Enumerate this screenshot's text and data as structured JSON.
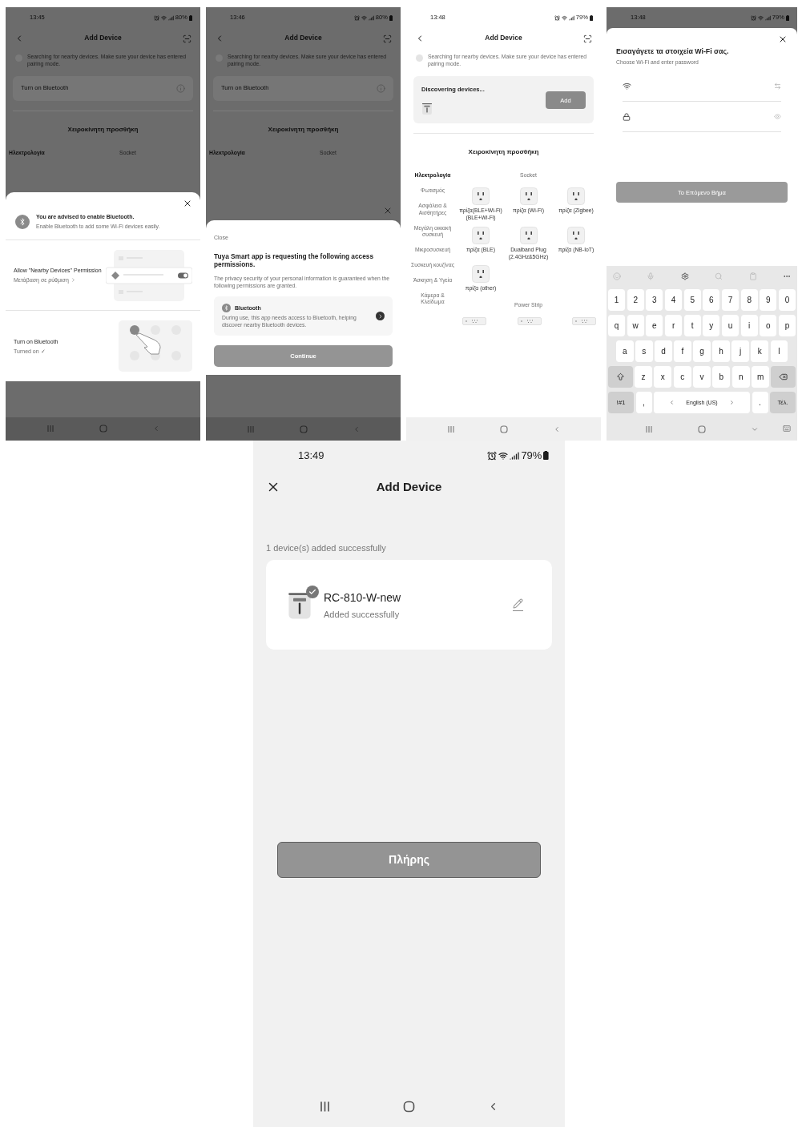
{
  "screens": [
    {
      "kind": "bluetooth_advice",
      "status": {
        "time": "13:45",
        "battery": "80%"
      },
      "title": "Add Device",
      "searching": "Searching for nearby devices. Make sure your device has entered pairing mode.",
      "bluetooth_card": "Turn on Bluetooth",
      "section_title": "Χειροκίνητη προσθήκη",
      "category": "Ηλεκτρολογία",
      "subcategory": "Socket",
      "sheet": {
        "title": "You are advised to enable Bluetooth.",
        "subtitle": "Enable Bluetooth to add some Wi-Fi devices easily.",
        "rows": [
          {
            "kind": "permission",
            "title": "Allow \"Nearby Devices\" Permission",
            "action": "Μετάβαση σε ρύθμιση"
          },
          {
            "kind": "bluetooth",
            "title": "Turn on Bluetooth",
            "action": "Turned on ✓"
          }
        ]
      }
    },
    {
      "kind": "permission_request",
      "status": {
        "time": "13:46",
        "battery": "80%"
      },
      "title": "Add Device",
      "searching": "Searching for nearby devices. Make sure your device has entered pairing mode.",
      "bluetooth_card": "Turn on Bluetooth",
      "section_title": "Χειροκίνητη προσθήκη",
      "category": "Ηλεκτρολογία",
      "subcategory": "Socket",
      "sheet": {
        "close": "Close",
        "title": "Tuya Smart app is requesting the following access permissions.",
        "note": "The privacy security of your personal information is guaranteed when the following permissions are granted.",
        "permission": {
          "name": "Bluetooth",
          "description": "During use, this app needs access to Bluetooth, helping discover nearby Bluetooth devices."
        },
        "button": "Continue"
      }
    },
    {
      "kind": "device_discovery",
      "status": {
        "time": "13:48",
        "battery": "79%"
      },
      "title": "Add Device",
      "searching": "Searching for nearby devices. Make sure your device has entered pairing mode.",
      "discovery": {
        "title": "Discovering devices...",
        "button": "Add"
      },
      "section_title": "Χειροκίνητη προσθήκη",
      "categories": [
        {
          "label": "Ηλεκτρολογία",
          "selected": true
        },
        {
          "label": "Φωτισμός",
          "selected": false
        },
        {
          "label": "Ασφάλεια & Αισθητήρες",
          "selected": false
        },
        {
          "label": "Μεγάλη οικιακή συσκευή",
          "selected": false
        },
        {
          "label": "Μικροσυσκευή",
          "selected": false
        },
        {
          "label": "Συσκευή κουζίνας",
          "selected": false
        },
        {
          "label": "Άσκηση & Υγεία",
          "selected": false
        },
        {
          "label": "Κάμερα & Κλείδωμα",
          "selected": false
        }
      ],
      "groups": [
        {
          "kind": "socket",
          "title": "Socket",
          "items": [
            "πρίζα(BLE+Wi-Fi) (BLE+Wi-Fi)",
            "πρίζα (Wi-Fi)",
            "πρίζα (Zigbee)",
            "πρίζα (BLE)",
            "Dualband Plug (2.4GHz&5GHz)",
            "πρίζα (NB-IoT)",
            "πρίζα (other)"
          ]
        },
        {
          "kind": "power_strip",
          "title": "Power Strip"
        }
      ]
    },
    {
      "kind": "wifi_form",
      "status": {
        "time": "13:48",
        "battery": "79%"
      },
      "sheet": {
        "title": "Εισαγάγετε τα στοιχεία Wi-Fi σας.",
        "subtitle": "Choose Wi-Fi and enter password",
        "button": "Το Επόμενο Βήμα"
      },
      "keyboard": {
        "digits": [
          "1",
          "2",
          "3",
          "4",
          "5",
          "6",
          "7",
          "8",
          "9",
          "0"
        ],
        "letters": [
          [
            "q",
            "w",
            "e",
            "r",
            "t",
            "y",
            "u",
            "i",
            "o",
            "p"
          ],
          [
            "a",
            "s",
            "d",
            "f",
            "g",
            "h",
            "j",
            "k",
            "l"
          ],
          [
            "z",
            "x",
            "c",
            "v",
            "b",
            "n",
            "m"
          ]
        ],
        "symbols": "!#1",
        "comma": ",",
        "language": "English (US)",
        "period": ".",
        "done": "Τέλ."
      }
    },
    {
      "kind": "success",
      "status": {
        "time": "13:49",
        "battery": "79%"
      },
      "title": "Add Device",
      "summary": "1 device(s) added successfully",
      "device": {
        "name": "RC-810-W-new",
        "status": "Added successfully"
      },
      "button": "Πλήρης"
    }
  ]
}
